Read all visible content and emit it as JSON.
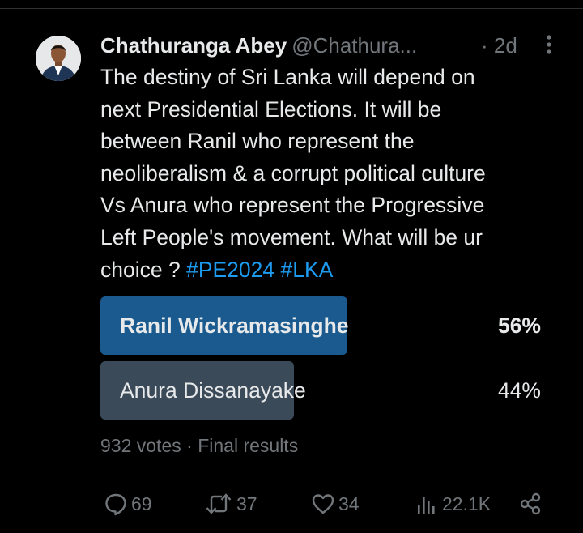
{
  "tweet": {
    "author_name": "Chathuranga Abey",
    "author_handle": "@Chathura...",
    "time": "· 2d",
    "text_main": "The destiny of Sri Lanka will depend on\nnext Presidential Elections. It will be\nbetween Ranil who represent the\nneoliberalism & a corrupt political culture\nVs Anura who represent the Progressive\nLeft People's movement. What will be ur\nchoice ? ",
    "hashtags": [
      "#PE2024",
      "#LKA"
    ]
  },
  "poll": {
    "options": [
      {
        "label": "Ranil Wickramasinghe",
        "percent_text": "56%",
        "share": 0.56,
        "winner": true
      },
      {
        "label": "Anura Dissanayake",
        "percent_text": "44%",
        "share": 0.44,
        "winner": false
      }
    ],
    "votes": "932 votes",
    "status": "Final results"
  },
  "actions": {
    "replies": "69",
    "reposts": "37",
    "likes": "34",
    "views": "22.1K"
  },
  "icons": {
    "more": "more-vertical-icon",
    "reply": "reply-icon",
    "repost": "repost-icon",
    "like": "heart-icon",
    "views": "views-chart-icon",
    "share": "share-icon"
  },
  "colors": {
    "background": "#000000",
    "text": "#e7e9ea",
    "secondary": "#71767b",
    "link": "#1d9bf0",
    "poll_winner": "#1a5a8f",
    "poll_other": "#3b4a58"
  }
}
